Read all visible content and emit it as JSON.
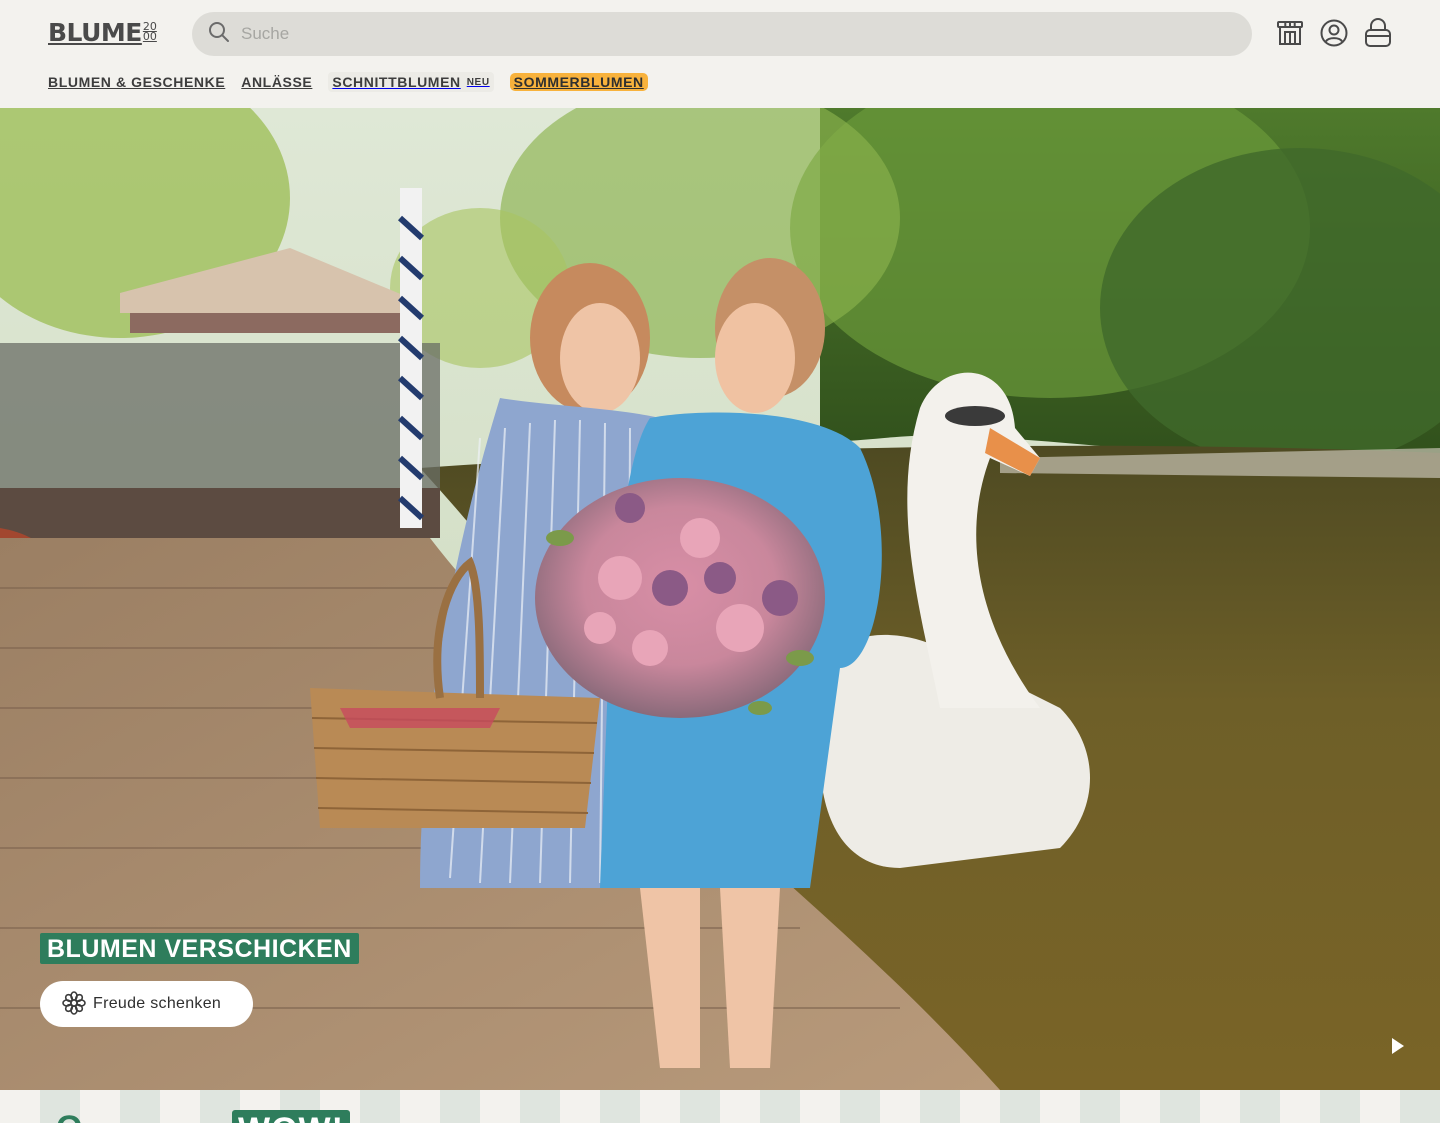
{
  "header": {
    "logo": {
      "word": "BLUME",
      "num_top": "20",
      "num_bottom": "00"
    },
    "search": {
      "placeholder": "Suche",
      "icon": "search-icon"
    },
    "icons": [
      "store-icon",
      "account-icon",
      "cart-icon"
    ]
  },
  "nav": {
    "items": [
      {
        "label": "Blumen & Geschenke"
      },
      {
        "label": "Anlässe"
      },
      {
        "label": "Schnittblumen",
        "badge": "Neu"
      },
      {
        "label": "Sommerblumen"
      }
    ]
  },
  "hero": {
    "title": "Blumen verschicken",
    "cta_label": "Freude schenken",
    "cta_icon": "flower-icon",
    "play_icon": "play-icon"
  },
  "next_section": {
    "heading_partial": "O",
    "badge_partial": "WOW!"
  },
  "colors": {
    "brand_green": "#2e7d5c",
    "accent_orange": "#f8b23c",
    "header_bg": "#f3f2ee",
    "search_bg": "#dddcd7"
  }
}
